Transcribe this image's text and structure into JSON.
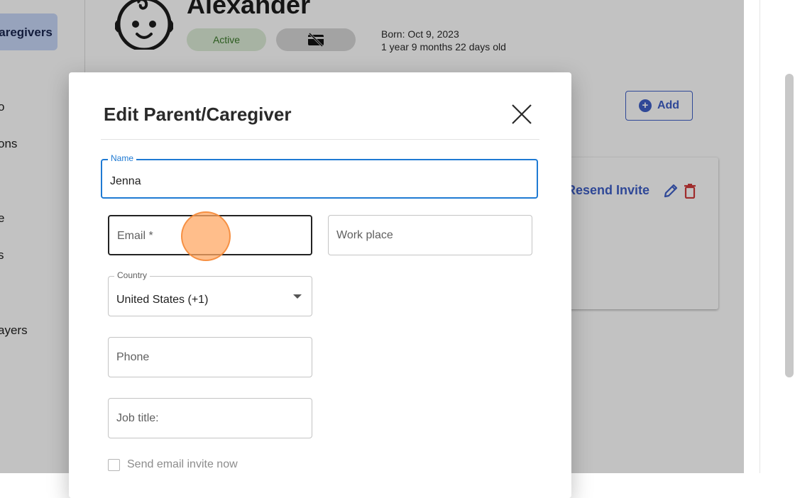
{
  "sidebar": {
    "active_item": "Caregivers",
    "items": [
      {
        "label": "o"
      },
      {
        "label": "ons"
      },
      {
        "label": "e"
      },
      {
        "label": "s"
      },
      {
        "label": "ayers"
      }
    ]
  },
  "child": {
    "name": "Alexander",
    "status": "Active",
    "born": "Born: Oct 9, 2023",
    "age": "1 year 9 months 22 days old",
    "card_icon": "no-card-icon"
  },
  "page": {
    "add_label": "Add",
    "resend_label": "Resend Invite"
  },
  "modal": {
    "title": "Edit Parent/Caregiver",
    "name_label": "Name",
    "name_value": "Jenna",
    "email_placeholder": "Email *",
    "work_placeholder": "Work place",
    "country_label": "Country",
    "country_value": "United States (+1)",
    "phone_placeholder": "Phone",
    "job_placeholder": "Job title:",
    "invite_label": "Send email invite now",
    "invite_checked": false
  },
  "colors": {
    "accent": "#3f5fc7",
    "focus": "#1f7ad3",
    "status_bg": "#dcebd6",
    "status_text": "#3b7a2a",
    "danger": "#d23b3b",
    "sidebar_active": "#c7d6f7"
  }
}
